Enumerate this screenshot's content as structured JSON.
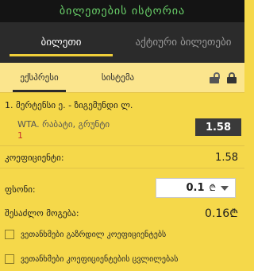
{
  "header": {
    "history_title": "ბილეთების ისტორია"
  },
  "main_tabs": [
    {
      "label": "ბილეთი",
      "active": true
    },
    {
      "label": "აქტიური ბილეთები",
      "active": false
    }
  ],
  "sub_tabs": [
    {
      "label": "ექსპრესი",
      "active": true
    },
    {
      "label": "სისტემა",
      "active": false
    }
  ],
  "sub_icons": [
    "lock-open-icon",
    "lock-icon"
  ],
  "bet": {
    "index": "1.",
    "title": "მერტენსი ე. - ზიგემუნდი ლ.",
    "tournament": "WTA. რაბატი, გრუნტი",
    "count": "1",
    "odd": "1.58",
    "remove_icon": "×"
  },
  "summary": {
    "coef_label": "კოეფიციენტი:",
    "coef_value": "1.58",
    "stake_label": "ფსონი:",
    "stake_value": "0.1",
    "currency": "₾",
    "win_label": "შესაძლო მოგება:",
    "win_value": "0.16₾"
  },
  "options": [
    {
      "label": "ვეთანხმები გაზრდილ კოეფიციენტებს",
      "checked": false
    },
    {
      "label": "ვეთანხმები კოეფიციენტების ცვლილებას",
      "checked": false
    }
  ],
  "colors": {
    "accent": "#f5d84a",
    "dark": "#2b2b2b",
    "green_text": "#6ad16a"
  }
}
